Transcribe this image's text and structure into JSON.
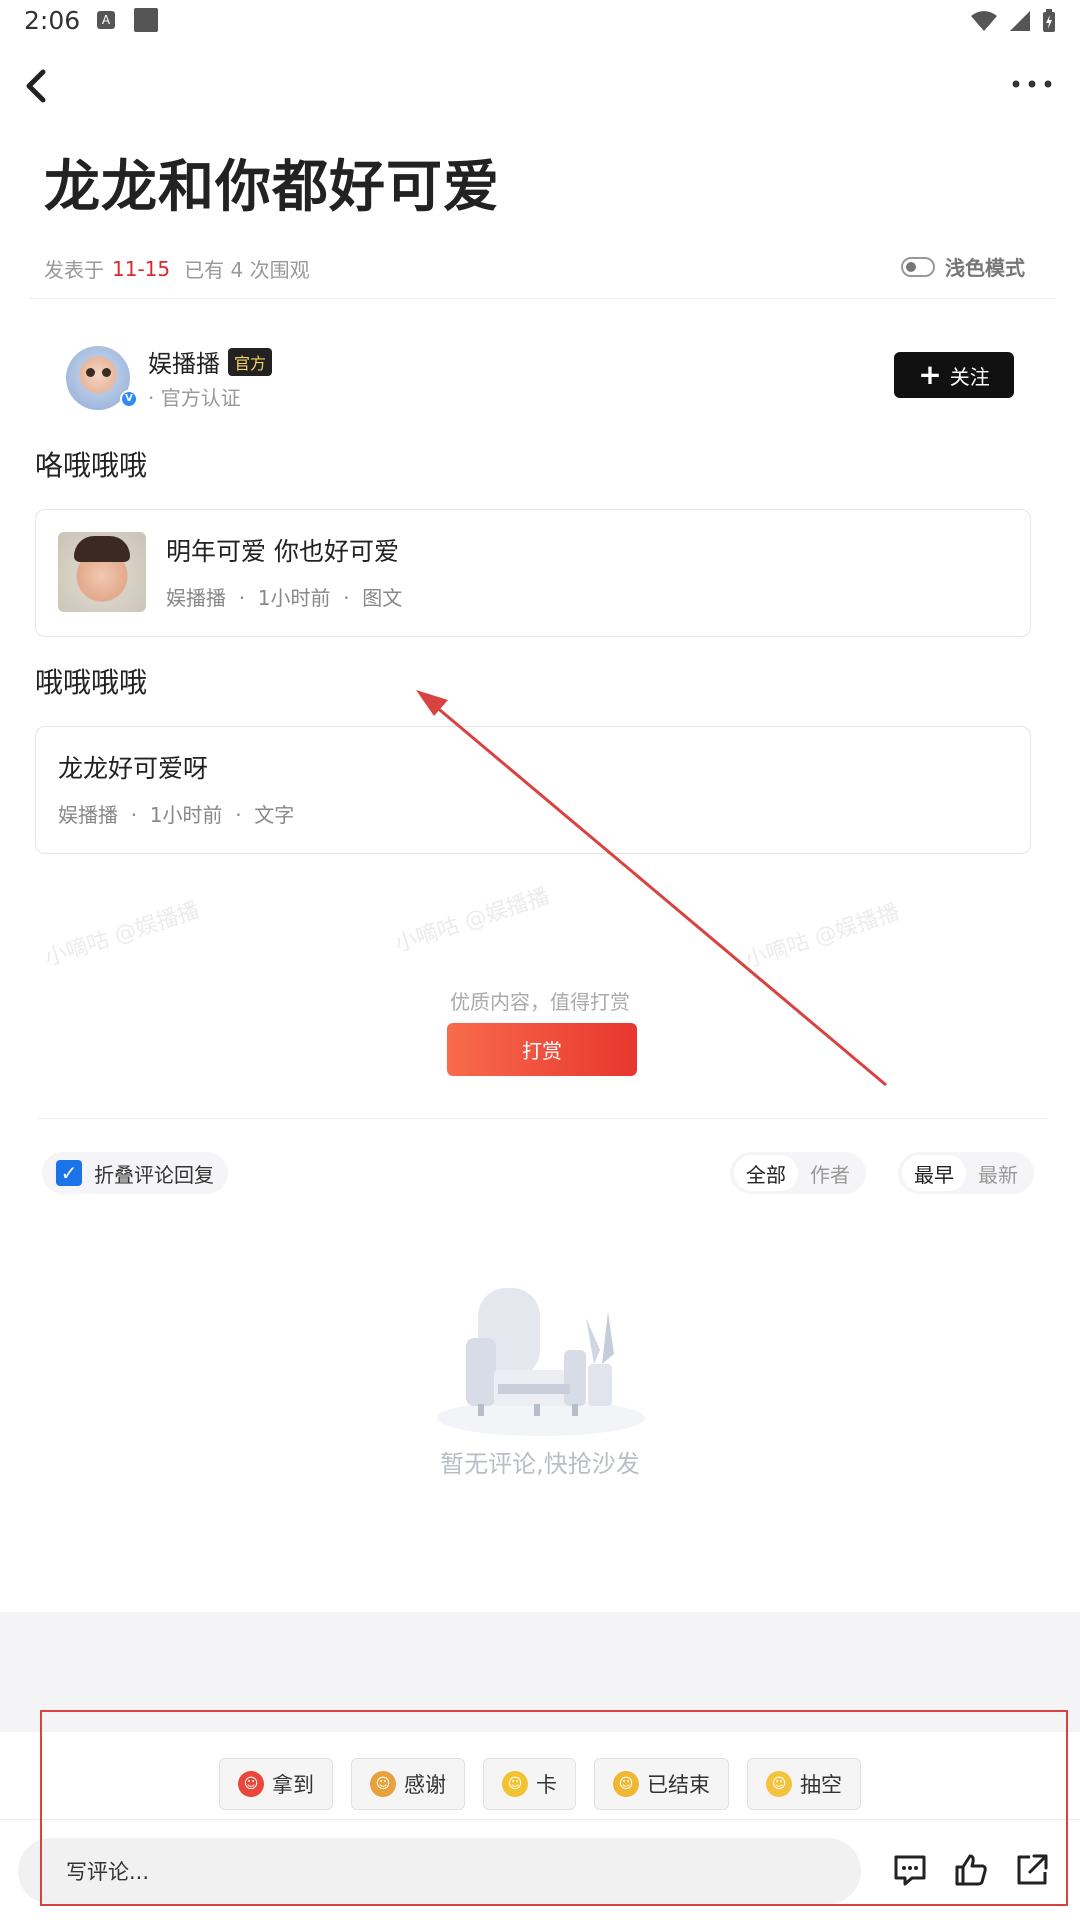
{
  "status_bar": {
    "time": "2:06",
    "a_icon": "A"
  },
  "article": {
    "title": "龙龙和你都好可爱",
    "meta_prefix": "发表于",
    "date": "11-15",
    "views": "已有 4 次围观",
    "theme_label": "浅色模式"
  },
  "author": {
    "name": "娱播播",
    "tag": "官方",
    "subtitle": "· 官方认证",
    "verified_mark": "V",
    "follow_label": "关注",
    "follow_plus": "+"
  },
  "sections": [
    {
      "heading": "咯哦哦哦",
      "card": {
        "title": "明年可爱 你也好可爱",
        "meta": "娱播播  ·  1小时前  ·  图文"
      }
    },
    {
      "heading": "哦哦哦哦",
      "card": {
        "title": "龙龙好可爱呀",
        "meta": "娱播播  ·  1小时前  ·  文字"
      }
    }
  ],
  "watermark": "小嘀咕 @娱播播",
  "tip": {
    "text": "优质内容，值得打赏",
    "button": "打赏"
  },
  "comments": {
    "collapse_label": "折叠评论回复",
    "collapse_checked": true,
    "check_glyph": "✓",
    "scope_tabs": [
      "全部",
      "作者"
    ],
    "order_tabs": [
      "最早",
      "最新"
    ],
    "empty_text": "暂无评论,快抢沙发"
  },
  "reactions": [
    {
      "label": "拿到",
      "emoji_color": "#e8473a"
    },
    {
      "label": "感谢",
      "emoji_color": "#e9a23b"
    },
    {
      "label": "卡",
      "emoji_color": "#f2c230"
    },
    {
      "label": "已结束",
      "emoji_color": "#f0b733"
    },
    {
      "label": "抽空",
      "emoji_color": "#f4c23c"
    }
  ],
  "input": {
    "placeholder": "写评论..."
  },
  "colors": {
    "accent_red": "#d92b2b",
    "annotation": "#d9433f",
    "check_blue": "#1a73e8"
  }
}
